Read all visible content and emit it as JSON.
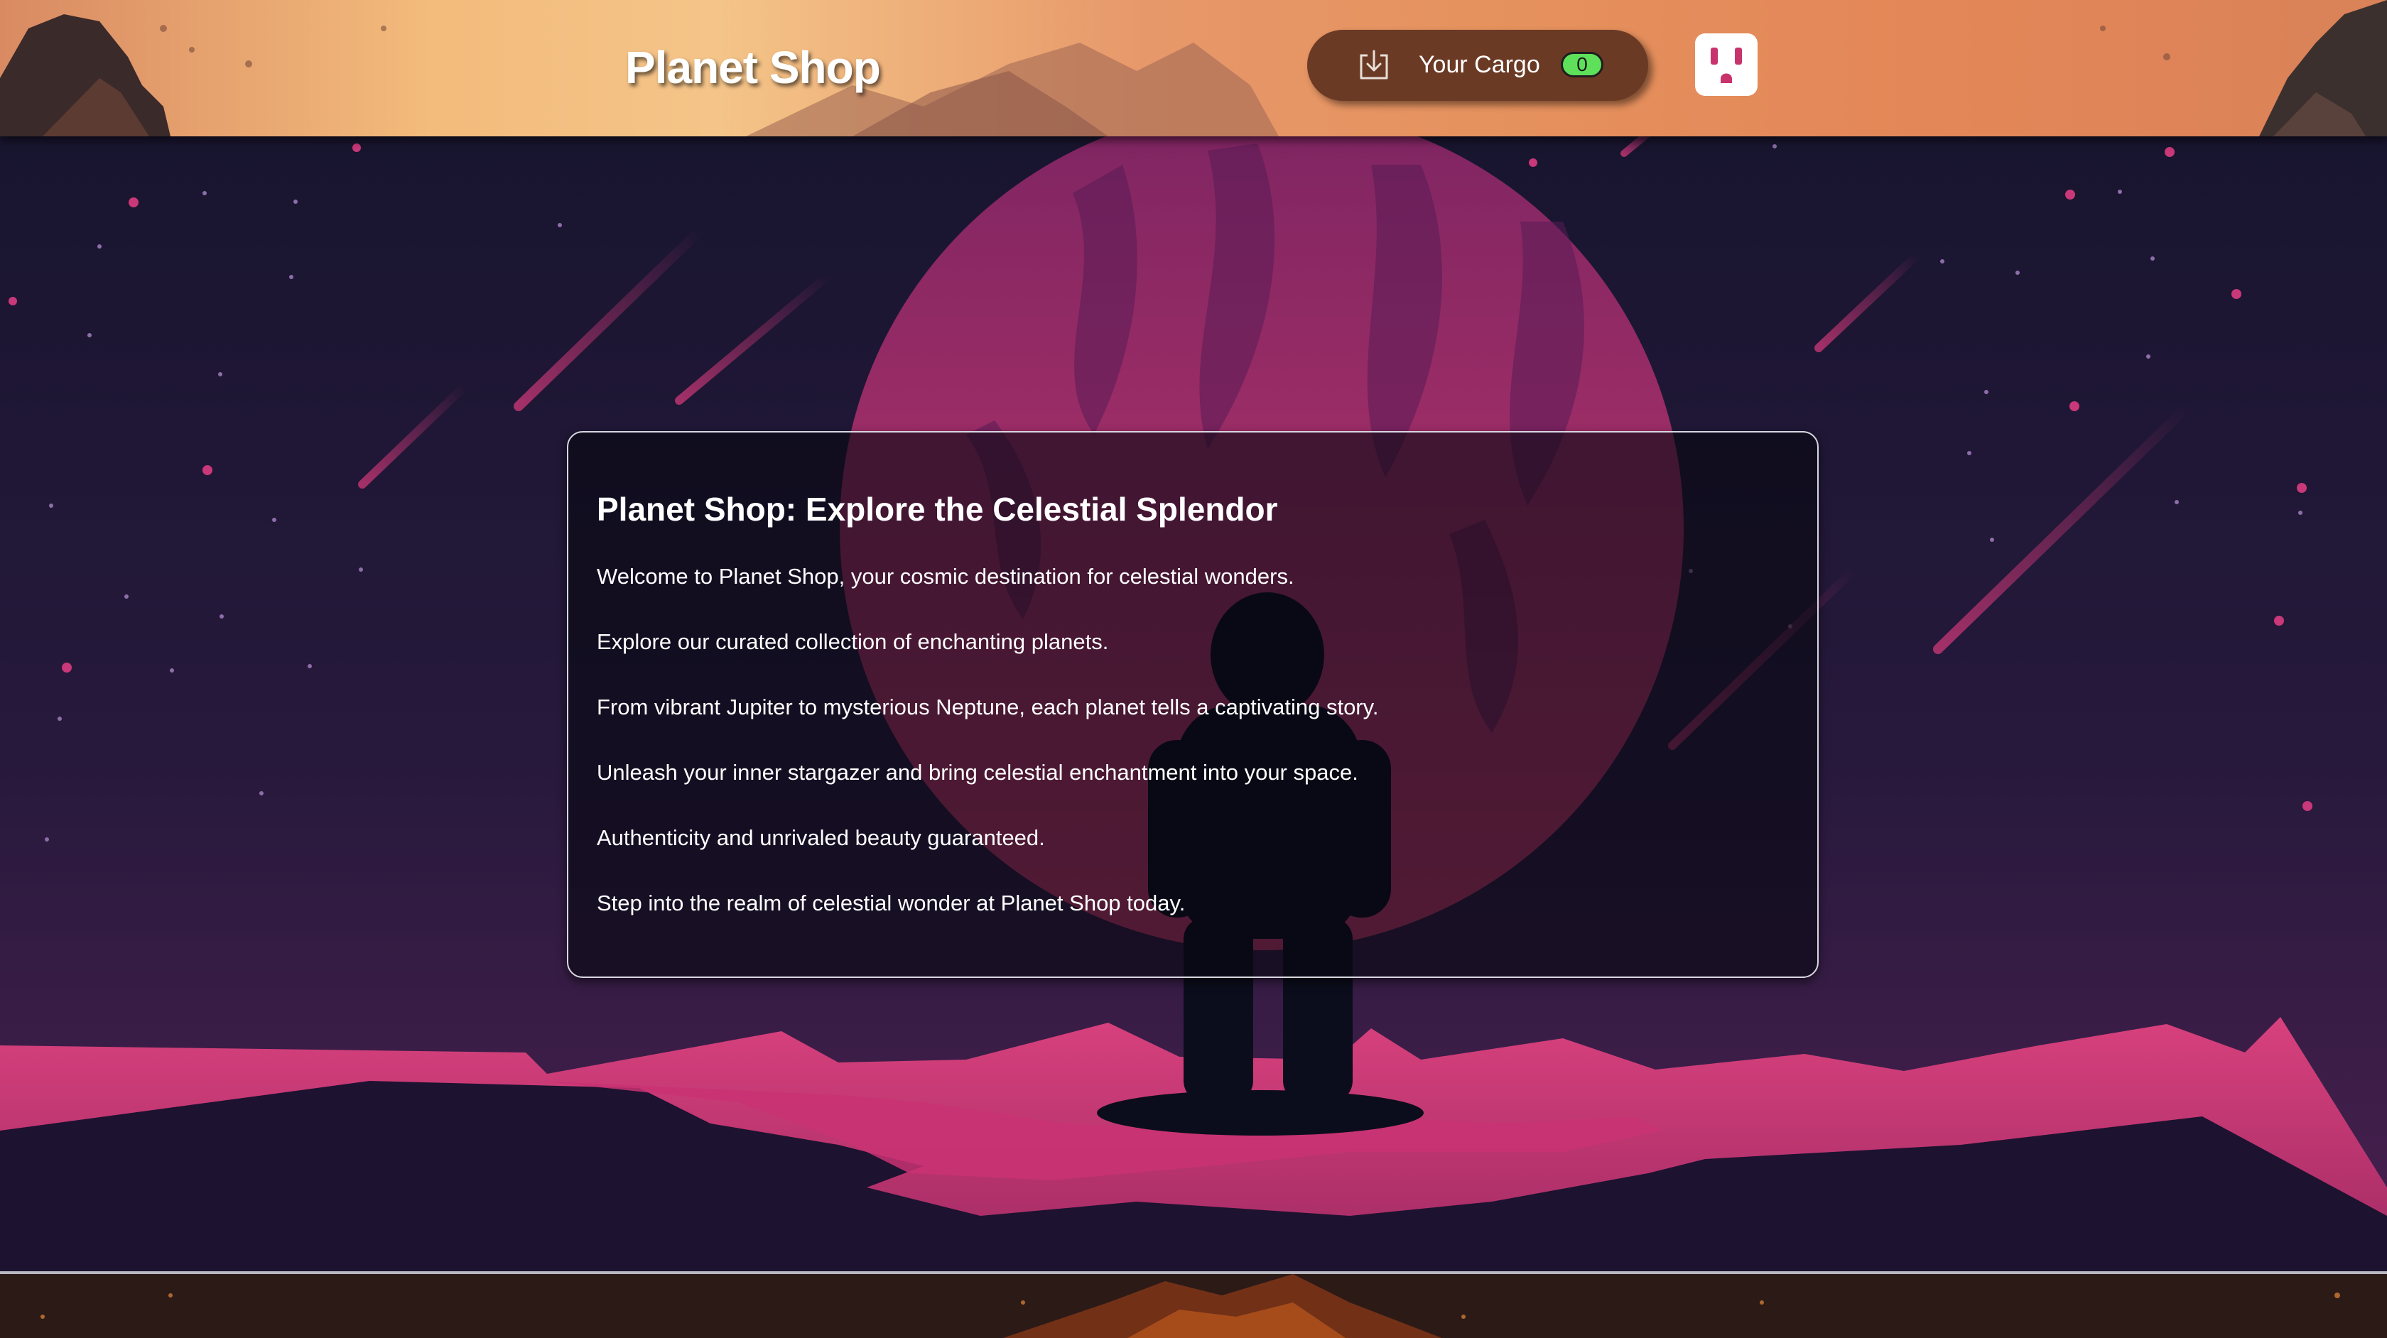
{
  "header": {
    "brand": "Planet Shop",
    "cargo": {
      "label": "Your Cargo",
      "count": "0",
      "icon": "download-tray-icon"
    },
    "profile_icon": "socket-face-icon"
  },
  "info_card": {
    "title": "Planet Shop: Explore the Celestial Splendor",
    "lines": [
      "Welcome to Planet Shop, your cosmic destination for celestial wonders.",
      "Explore our curated collection of enchanting planets.",
      "From vibrant Jupiter to mysterious Neptune, each planet tells a captivating story.",
      "Unleash your inner stargazer and bring celestial enchantment into your space.",
      "Authenticity and unrivaled beauty guaranteed.",
      "Step into the realm of celestial wonder at Planet Shop today."
    ]
  },
  "colors": {
    "sky_top": "#1b1633",
    "sky_bottom": "#3d1c45",
    "planet": "#b8316e",
    "ground": "#d23e7b",
    "cargo_bg": "#6b3a25",
    "badge": "#5fe05a"
  }
}
